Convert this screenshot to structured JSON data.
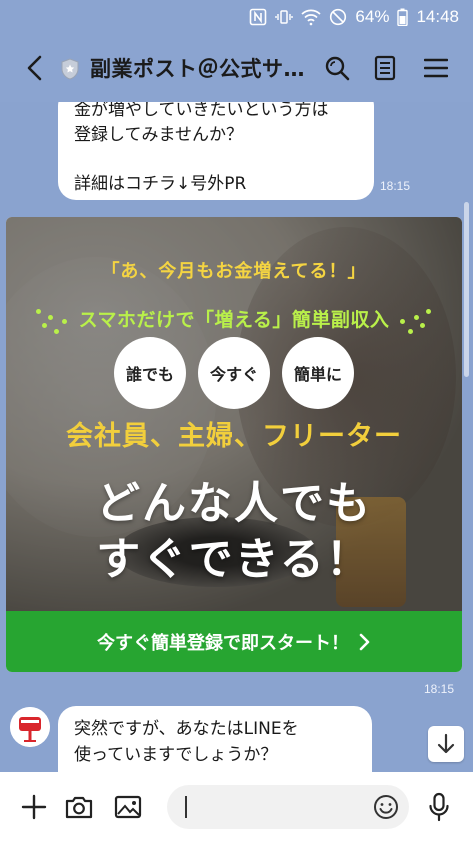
{
  "status_bar": {
    "battery": "64%",
    "time": "14:48"
  },
  "header": {
    "title": "副業ポスト＠公式サ…"
  },
  "messages": {
    "top_bubble": {
      "lines": [
        "金が増やしていきたいという方は",
        "登録してみませんか？",
        "詳細はコチラ↓号外PR"
      ],
      "time": "18:15"
    },
    "banner": {
      "catch": "「あ、今月もお金増えてる！」",
      "sub": "スマホだけで「増える」簡単副収入",
      "badges": [
        "誰でも",
        "今すぐ",
        "簡単に"
      ],
      "targets": "会社員、主婦、フリーター",
      "headline_1": "どんな人でも",
      "headline_2": "すぐできる！",
      "cta": "今すぐ簡単登録で即スタート！",
      "time": "18:15"
    },
    "bottom_bubble": {
      "lines": [
        "突然ですが、あなたはLINEを",
        "使っていますでしょうか？"
      ]
    }
  },
  "colors": {
    "accent_green": "#27a531",
    "chat_background": "#8aa3cf",
    "banner_yellow": "#f2cf3c",
    "banner_lime": "#b9f04a"
  },
  "icons": {
    "status": [
      "nfc-icon",
      "vibrate-icon",
      "wifi-icon",
      "do-not-disturb-icon",
      "battery-icon"
    ],
    "header": [
      "back-icon",
      "official-shield-icon",
      "search-icon",
      "notes-icon",
      "menu-icon"
    ],
    "input": [
      "plus-icon",
      "camera-icon",
      "image-icon",
      "emoji-icon",
      "microphone-icon"
    ]
  }
}
